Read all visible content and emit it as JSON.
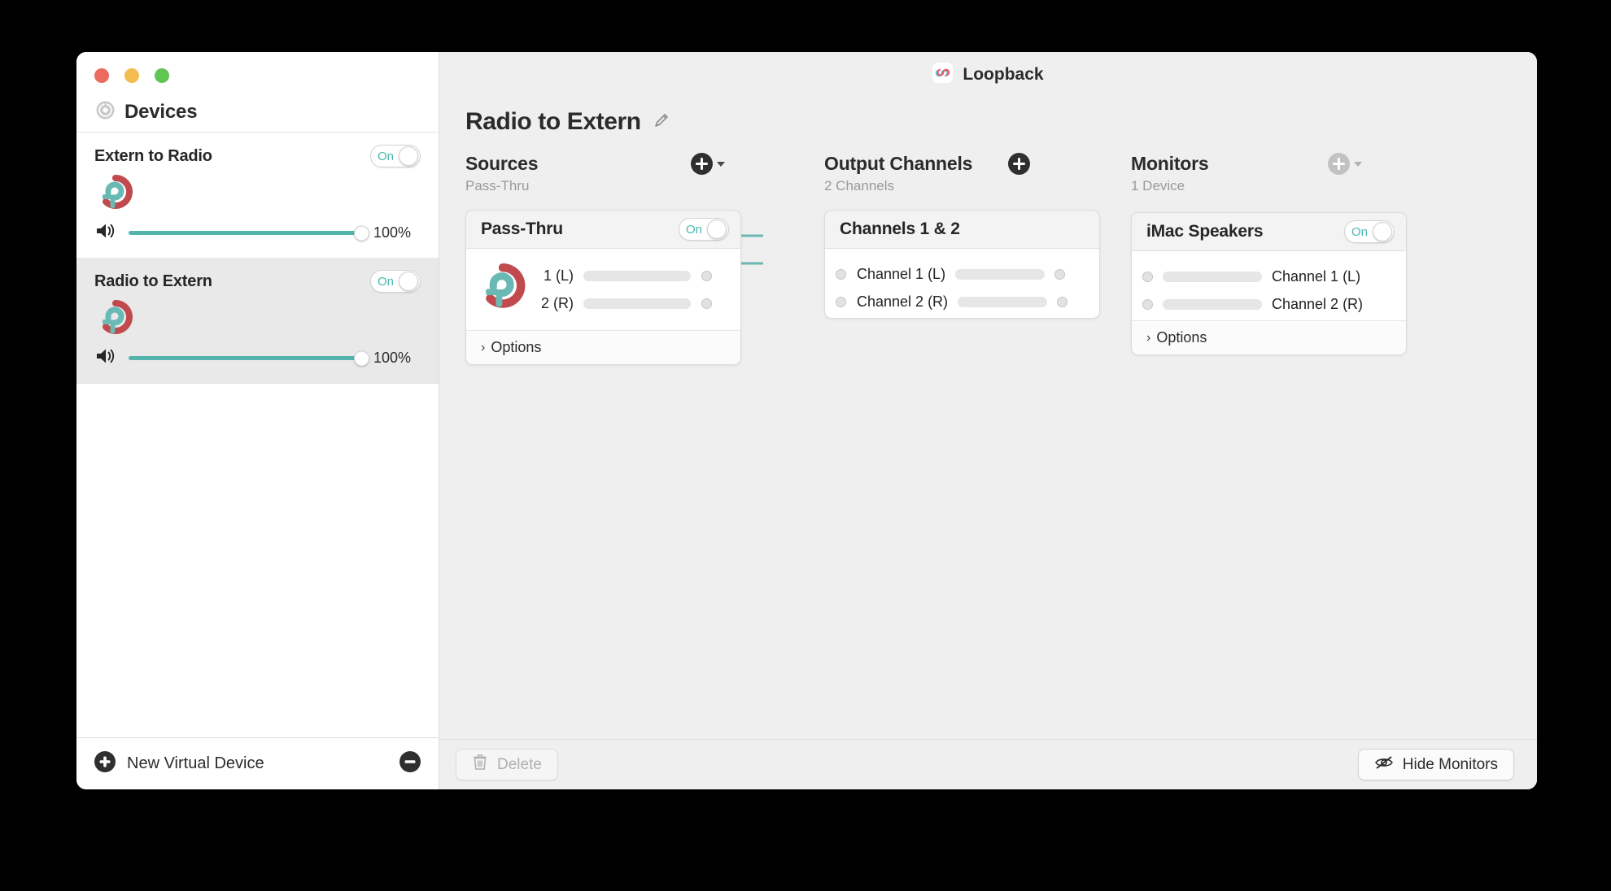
{
  "window": {
    "traffic_lights": [
      "close",
      "minimize",
      "zoom"
    ],
    "app_title": "Loopback",
    "app_icon": "loopback-app-icon"
  },
  "sidebar": {
    "header": {
      "title": "Devices",
      "icon": "devices-target-icon"
    },
    "devices": [
      {
        "name": "Extern to Radio",
        "toggle_label": "On",
        "toggle_state": "on",
        "logo_icon": "loopback-device-icon",
        "volume_icon": "speaker-volume-icon",
        "volume_value": "100%",
        "volume_percent": 100,
        "selected": false
      },
      {
        "name": "Radio to Extern",
        "toggle_label": "On",
        "toggle_state": "on",
        "logo_icon": "loopback-device-icon",
        "volume_icon": "speaker-volume-icon",
        "volume_value": "100%",
        "volume_percent": 100,
        "selected": true
      }
    ],
    "footer": {
      "new_device_label": "New Virtual Device",
      "new_device_icon": "plus-circle-icon",
      "remove_device_icon": "minus-circle-icon"
    }
  },
  "main": {
    "document_title": "Radio to Extern",
    "edit_icon": "pencil-edit-icon",
    "columns": {
      "sources": {
        "title": "Sources",
        "subtitle": "Pass-Thru",
        "add_icon": "plus-circle-icon",
        "has_caret": true,
        "card": {
          "title": "Pass-Thru",
          "toggle_label": "On",
          "toggle_state": "on",
          "icon": "loopback-source-icon",
          "channels": [
            {
              "label": "1 (L)",
              "meter_level": 0
            },
            {
              "label": "2 (R)",
              "meter_level": 0
            }
          ],
          "options_label": "Options",
          "options_icon": "chevron-right-icon"
        }
      },
      "output_channels": {
        "title": "Output Channels",
        "subtitle": "2 Channels",
        "add_icon": "plus-circle-icon",
        "has_caret": false,
        "card": {
          "title": "Channels 1 & 2",
          "channels": [
            {
              "label": "Channel 1 (L)",
              "meter_level": 0
            },
            {
              "label": "Channel 2 (R)",
              "meter_level": 0
            }
          ]
        }
      },
      "monitors": {
        "title": "Monitors",
        "subtitle": "1 Device",
        "add_icon": "plus-circle-icon",
        "add_disabled": true,
        "has_caret": true,
        "card": {
          "title": "iMac Speakers",
          "toggle_label": "On",
          "toggle_state": "on",
          "channels": [
            {
              "label": "Channel 1 (L)",
              "meter_level": 0
            },
            {
              "label": "Channel 2 (R)",
              "meter_level": 0
            }
          ],
          "options_label": "Options",
          "options_icon": "chevron-right-icon"
        }
      }
    },
    "bottom_bar": {
      "delete_label": "Delete",
      "delete_icon": "trash-icon",
      "delete_disabled": true,
      "hide_monitors_label": "Hide Monitors",
      "hide_monitors_icon": "eye-slash-icon"
    }
  },
  "colors": {
    "accent_teal": "#55b3ad",
    "cable_teal": "#6cb7b3",
    "logo_red": "#c04a4d",
    "logo_teal": "#6bb9b4",
    "desktop_bg": "#000000",
    "canvas_bg": "#efefef",
    "sidebar_bg": "#ffffff",
    "selected_row_bg": "#e9e9e9"
  }
}
